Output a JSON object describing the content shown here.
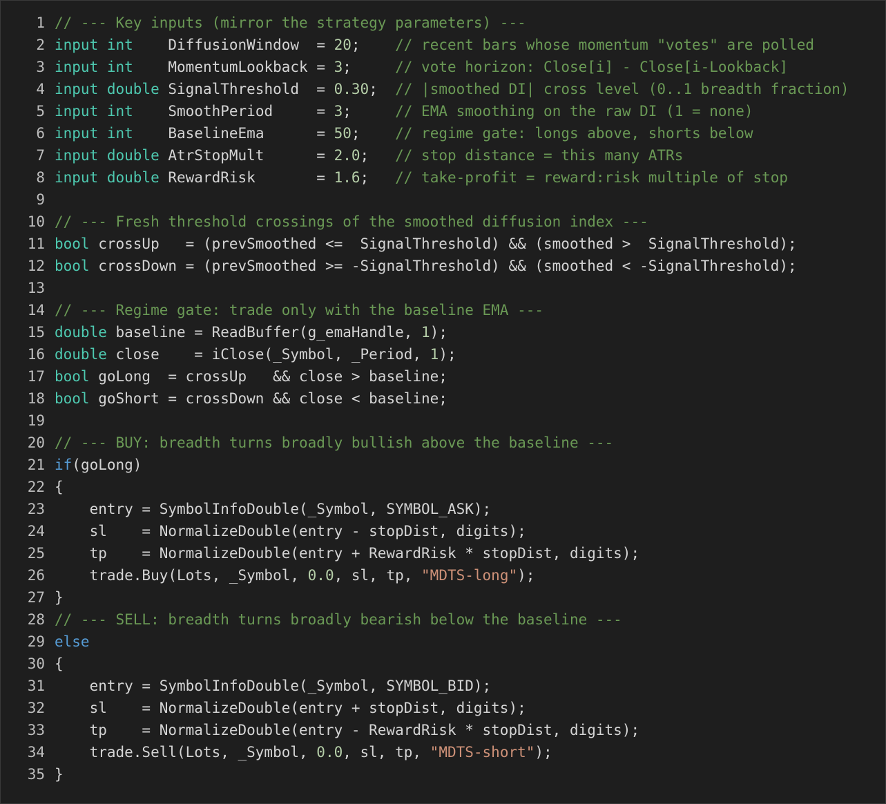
{
  "editor": {
    "theme": {
      "background": "#1e1e1e",
      "text": "#d4d4d4",
      "keyword": "#569cd6",
      "type": "#4ec9b0",
      "number": "#b5cea8",
      "string": "#ce9178",
      "comment": "#6a9955",
      "line_number": "#bdbdbd"
    },
    "lines": [
      {
        "n": "1",
        "tokens": [
          {
            "t": "// --- Key inputs (mirror the strategy parameters) ---",
            "k": "cm"
          }
        ]
      },
      {
        "n": "2",
        "tokens": [
          {
            "t": "input",
            "k": "type"
          },
          {
            "t": " ",
            "k": "p"
          },
          {
            "t": "int",
            "k": "type"
          },
          {
            "t": "    DiffusionWindow  = ",
            "k": "id"
          },
          {
            "t": "20",
            "k": "num"
          },
          {
            "t": ";    ",
            "k": "p"
          },
          {
            "t": "// recent bars whose momentum \"votes\" are polled",
            "k": "cm"
          }
        ]
      },
      {
        "n": "3",
        "tokens": [
          {
            "t": "input",
            "k": "type"
          },
          {
            "t": " ",
            "k": "p"
          },
          {
            "t": "int",
            "k": "type"
          },
          {
            "t": "    MomentumLookback = ",
            "k": "id"
          },
          {
            "t": "3",
            "k": "num"
          },
          {
            "t": ";     ",
            "k": "p"
          },
          {
            "t": "// vote horizon: Close[i] - Close[i-Lookback]",
            "k": "cm"
          }
        ]
      },
      {
        "n": "4",
        "tokens": [
          {
            "t": "input",
            "k": "type"
          },
          {
            "t": " ",
            "k": "p"
          },
          {
            "t": "double",
            "k": "type"
          },
          {
            "t": " SignalThreshold  = ",
            "k": "id"
          },
          {
            "t": "0.30",
            "k": "num"
          },
          {
            "t": ";  ",
            "k": "p"
          },
          {
            "t": "// |smoothed DI| cross level (0..1 breadth fraction)",
            "k": "cm"
          }
        ]
      },
      {
        "n": "5",
        "tokens": [
          {
            "t": "input",
            "k": "type"
          },
          {
            "t": " ",
            "k": "p"
          },
          {
            "t": "int",
            "k": "type"
          },
          {
            "t": "    SmoothPeriod     = ",
            "k": "id"
          },
          {
            "t": "3",
            "k": "num"
          },
          {
            "t": ";     ",
            "k": "p"
          },
          {
            "t": "// EMA smoothing on the raw DI (1 = none)",
            "k": "cm"
          }
        ]
      },
      {
        "n": "6",
        "tokens": [
          {
            "t": "input",
            "k": "type"
          },
          {
            "t": " ",
            "k": "p"
          },
          {
            "t": "int",
            "k": "type"
          },
          {
            "t": "    BaselineEma      = ",
            "k": "id"
          },
          {
            "t": "50",
            "k": "num"
          },
          {
            "t": ";    ",
            "k": "p"
          },
          {
            "t": "// regime gate: longs above, shorts below",
            "k": "cm"
          }
        ]
      },
      {
        "n": "7",
        "tokens": [
          {
            "t": "input",
            "k": "type"
          },
          {
            "t": " ",
            "k": "p"
          },
          {
            "t": "double",
            "k": "type"
          },
          {
            "t": " AtrStopMult      = ",
            "k": "id"
          },
          {
            "t": "2.0",
            "k": "num"
          },
          {
            "t": ";   ",
            "k": "p"
          },
          {
            "t": "// stop distance = this many ATRs",
            "k": "cm"
          }
        ]
      },
      {
        "n": "8",
        "tokens": [
          {
            "t": "input",
            "k": "type"
          },
          {
            "t": " ",
            "k": "p"
          },
          {
            "t": "double",
            "k": "type"
          },
          {
            "t": " RewardRisk       = ",
            "k": "id"
          },
          {
            "t": "1.6",
            "k": "num"
          },
          {
            "t": ";   ",
            "k": "p"
          },
          {
            "t": "// take-profit = reward:risk multiple of stop",
            "k": "cm"
          }
        ]
      },
      {
        "n": "9",
        "tokens": []
      },
      {
        "n": "10",
        "tokens": [
          {
            "t": "// --- Fresh threshold crossings of the smoothed diffusion index ---",
            "k": "cm"
          }
        ]
      },
      {
        "n": "11",
        "tokens": [
          {
            "t": "bool",
            "k": "type"
          },
          {
            "t": " crossUp   = (prevSmoothed <=  SignalThreshold) && (smoothed >  SignalThreshold);",
            "k": "id"
          }
        ]
      },
      {
        "n": "12",
        "tokens": [
          {
            "t": "bool",
            "k": "type"
          },
          {
            "t": " crossDown = (prevSmoothed >= -SignalThreshold) && (smoothed < -SignalThreshold);",
            "k": "id"
          }
        ]
      },
      {
        "n": "13",
        "tokens": []
      },
      {
        "n": "14",
        "tokens": [
          {
            "t": "// --- Regime gate: trade only with the baseline EMA ---",
            "k": "cm"
          }
        ]
      },
      {
        "n": "15",
        "tokens": [
          {
            "t": "double",
            "k": "type"
          },
          {
            "t": " baseline = ReadBuffer(g_emaHandle, ",
            "k": "id"
          },
          {
            "t": "1",
            "k": "num"
          },
          {
            "t": ");",
            "k": "p"
          }
        ]
      },
      {
        "n": "16",
        "tokens": [
          {
            "t": "double",
            "k": "type"
          },
          {
            "t": " close    = iClose(_Symbol, _Period, ",
            "k": "id"
          },
          {
            "t": "1",
            "k": "num"
          },
          {
            "t": ");",
            "k": "p"
          }
        ]
      },
      {
        "n": "17",
        "tokens": [
          {
            "t": "bool",
            "k": "type"
          },
          {
            "t": " goLong  = crossUp   && close > baseline;",
            "k": "id"
          }
        ]
      },
      {
        "n": "18",
        "tokens": [
          {
            "t": "bool",
            "k": "type"
          },
          {
            "t": " goShort = crossDown && close < baseline;",
            "k": "id"
          }
        ]
      },
      {
        "n": "19",
        "tokens": []
      },
      {
        "n": "20",
        "tokens": [
          {
            "t": "// --- BUY: breadth turns broadly bullish above the baseline ---",
            "k": "cm"
          }
        ]
      },
      {
        "n": "21",
        "tokens": [
          {
            "t": "if",
            "k": "kw"
          },
          {
            "t": "(goLong)",
            "k": "id"
          }
        ]
      },
      {
        "n": "22",
        "tokens": [
          {
            "t": "{",
            "k": "p"
          }
        ]
      },
      {
        "n": "23",
        "tokens": [
          {
            "t": "    entry = SymbolInfoDouble(_Symbol, SYMBOL_ASK);",
            "k": "id"
          }
        ]
      },
      {
        "n": "24",
        "tokens": [
          {
            "t": "    sl    = NormalizeDouble(entry - stopDist, digits);",
            "k": "id"
          }
        ]
      },
      {
        "n": "25",
        "tokens": [
          {
            "t": "    tp    = NormalizeDouble(entry + RewardRisk * stopDist, digits);",
            "k": "id"
          }
        ]
      },
      {
        "n": "26",
        "tokens": [
          {
            "t": "    trade.Buy(Lots, _Symbol, ",
            "k": "id"
          },
          {
            "t": "0.0",
            "k": "num"
          },
          {
            "t": ", sl, tp, ",
            "k": "p"
          },
          {
            "t": "\"MDTS-long\"",
            "k": "str"
          },
          {
            "t": ");",
            "k": "p"
          }
        ]
      },
      {
        "n": "27",
        "tokens": [
          {
            "t": "}",
            "k": "p"
          }
        ]
      },
      {
        "n": "28",
        "tokens": [
          {
            "t": "// --- SELL: breadth turns broadly bearish below the baseline ---",
            "k": "cm"
          }
        ]
      },
      {
        "n": "29",
        "tokens": [
          {
            "t": "else",
            "k": "kw"
          }
        ]
      },
      {
        "n": "30",
        "tokens": [
          {
            "t": "{",
            "k": "p"
          }
        ]
      },
      {
        "n": "31",
        "tokens": [
          {
            "t": "    entry = SymbolInfoDouble(_Symbol, SYMBOL_BID);",
            "k": "id"
          }
        ]
      },
      {
        "n": "32",
        "tokens": [
          {
            "t": "    sl    = NormalizeDouble(entry + stopDist, digits);",
            "k": "id"
          }
        ]
      },
      {
        "n": "33",
        "tokens": [
          {
            "t": "    tp    = NormalizeDouble(entry - RewardRisk * stopDist, digits);",
            "k": "id"
          }
        ]
      },
      {
        "n": "34",
        "tokens": [
          {
            "t": "    trade.Sell(Lots, _Symbol, ",
            "k": "id"
          },
          {
            "t": "0.0",
            "k": "num"
          },
          {
            "t": ", sl, tp, ",
            "k": "p"
          },
          {
            "t": "\"MDTS-short\"",
            "k": "str"
          },
          {
            "t": ");",
            "k": "p"
          }
        ]
      },
      {
        "n": "35",
        "tokens": [
          {
            "t": "}",
            "k": "p"
          }
        ]
      }
    ]
  }
}
